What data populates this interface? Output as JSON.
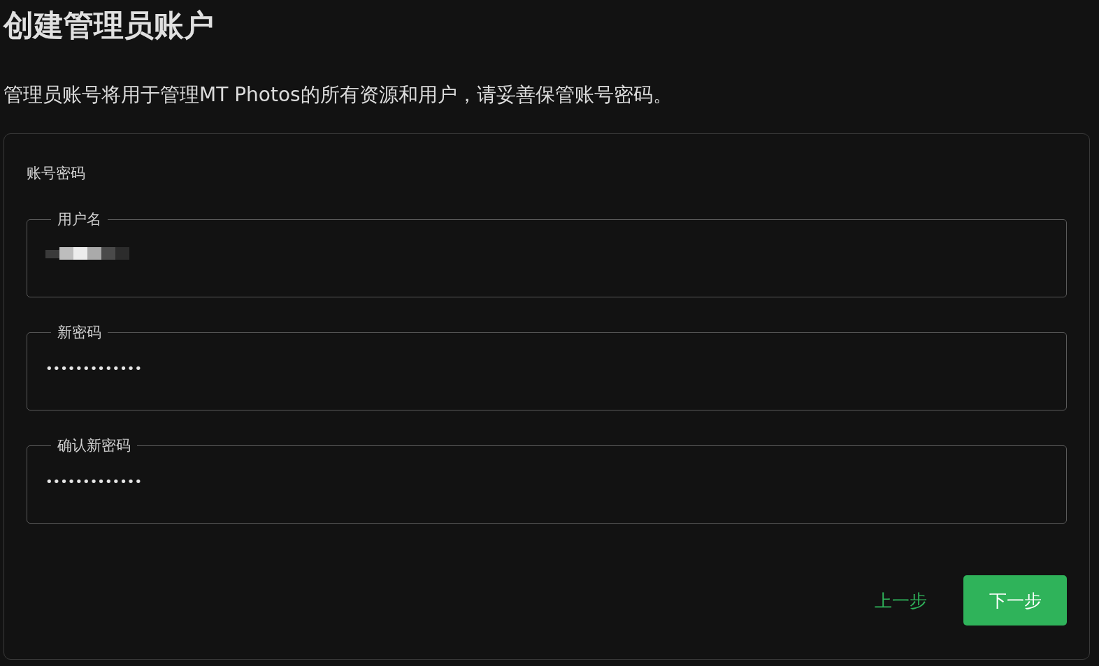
{
  "title": "创建管理员账户",
  "description": "管理员账号将用于管理MT Photos的所有资源和用户，请妥善保管账号密码。",
  "section_label": "账号密码",
  "fields": [
    {
      "kind": "redacted",
      "label": "用户名"
    },
    {
      "kind": "text",
      "label": "新密码",
      "value": "•••••••••••••"
    },
    {
      "kind": "text",
      "label": "确认新密码",
      "value": "•••••••••••••"
    }
  ],
  "buttons": [
    {
      "kind": "text",
      "label": "上一步"
    },
    {
      "kind": "filled",
      "label": "下一步"
    }
  ]
}
